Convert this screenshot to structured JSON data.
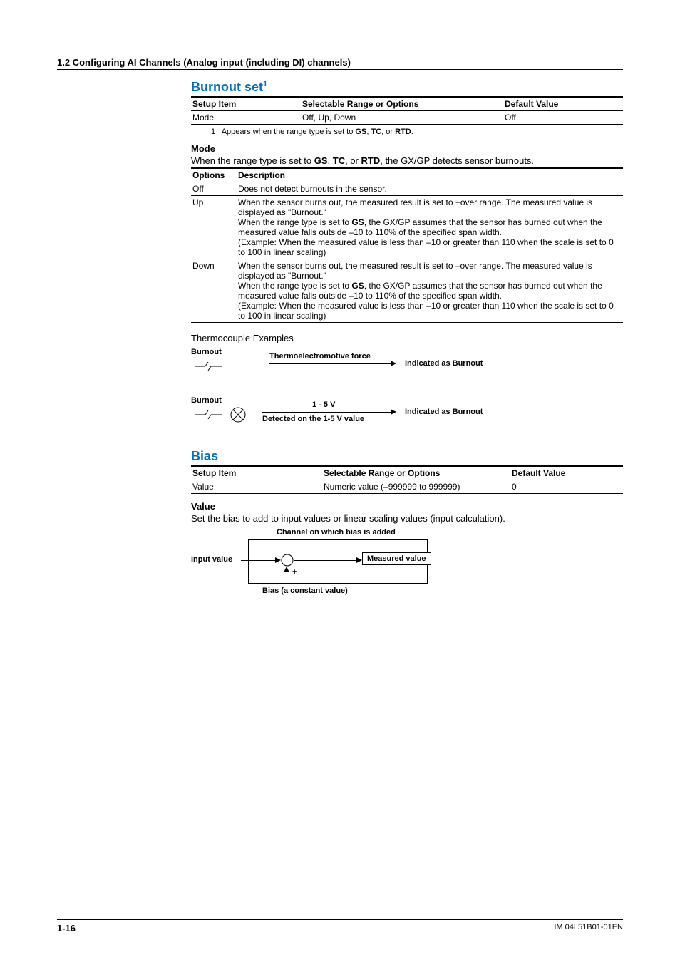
{
  "header": {
    "section": "1.2  Configuring AI Channels (Analog input (including DI) channels)"
  },
  "burnout": {
    "title": "Burnout set",
    "sup": "1",
    "table": {
      "headers": {
        "c1": "Setup Item",
        "c2": "Selectable Range or Options",
        "c3": "Default Value"
      },
      "row": {
        "c1": "Mode",
        "c2": "Off, Up, Down",
        "c3": "Off"
      }
    },
    "footnote_num": "1",
    "footnote": "Appears when the range type is set to GS, TC, or RTD.",
    "mode": {
      "heading": "Mode",
      "intro_pre": "When the range type is set to ",
      "intro_bold1": "GS",
      "intro_sep1": ", ",
      "intro_bold2": "TC",
      "intro_sep2": ", or ",
      "intro_bold3": "RTD",
      "intro_post": ", the GX/GP detects sensor burnouts.",
      "headers": {
        "c1": "Options",
        "c2": "Description"
      },
      "rows": {
        "off": {
          "opt": "Off",
          "desc": "Does not detect burnouts in the sensor."
        },
        "up": {
          "opt": "Up",
          "line1": "When the sensor burns out, the measured result is set to +over range. The measured value is displayed as \"Burnout.\"",
          "line2a": "When the range type is set to ",
          "line2bold": "GS",
          "line2b": ", the GX/GP assumes that the sensor has burned out when the measured value falls outside –10 to 110% of the specified span width.",
          "line3": "(Example: When the measured value is less than –10 or greater than 110 when the scale is set to 0 to 100 in linear scaling)"
        },
        "down": {
          "opt": "Down",
          "line1": "When the sensor burns out, the measured result is set to –over range. The measured value is displayed as \"Burnout.\"",
          "line2a": "When the range type is set to ",
          "line2bold": "GS",
          "line2b": ", the GX/GP assumes that the sensor has burned out when the measured value falls outside –10 to 110% of the specified span width.",
          "line3": "(Example: When the measured value is less than –10 or greater than 110 when the scale is set to 0 to 100 in linear scaling)"
        }
      }
    },
    "examples": {
      "title": "Thermocouple Examples",
      "d1": {
        "burnout": "Burnout",
        "top": "Thermoelectromotive force",
        "right": "Indicated as Burnout"
      },
      "d2": {
        "burnout": "Burnout",
        "top": "1 - 5 V",
        "bottom": "Detected on the 1-5 V value",
        "right": "Indicated as Burnout"
      }
    }
  },
  "bias": {
    "title": "Bias",
    "table": {
      "headers": {
        "c1": "Setup Item",
        "c2": "Selectable Range or Options",
        "c3": "Default Value"
      },
      "row": {
        "c1": "Value",
        "c2": "Numeric value (–999999 to 999999)",
        "c3": "0"
      }
    },
    "value": {
      "heading": "Value",
      "text": "Set the bias to add to input values or linear scaling values (input calculation).",
      "diag": {
        "top": "Channel on which bias is added",
        "left": "Input value",
        "right": "Measured value",
        "plus": "+",
        "bottom": "Bias (a constant value)"
      }
    }
  },
  "footer": {
    "page": "1-16",
    "doc": "IM 04L51B01-01EN"
  }
}
